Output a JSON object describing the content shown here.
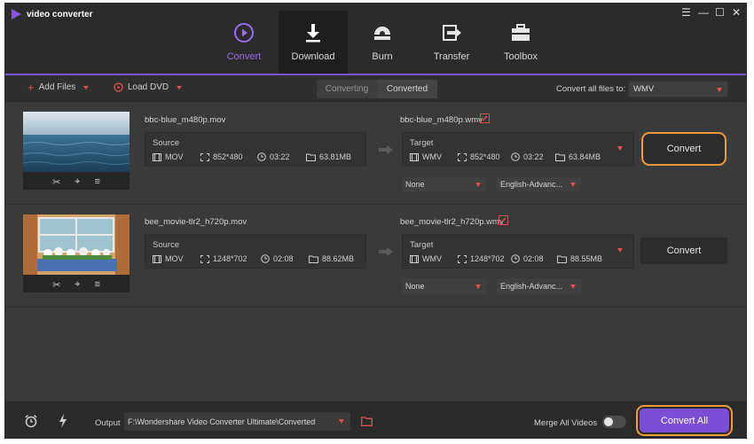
{
  "app": {
    "title": "video converter",
    "window_controls": [
      "menu",
      "minimize",
      "maximize",
      "close"
    ]
  },
  "nav": {
    "items": [
      {
        "label": "Convert",
        "icon": "convert-icon",
        "state": "active"
      },
      {
        "label": "Download",
        "icon": "download-icon",
        "state": "hover"
      },
      {
        "label": "Burn",
        "icon": "burn-icon",
        "state": "normal"
      },
      {
        "label": "Transfer",
        "icon": "transfer-icon",
        "state": "normal"
      },
      {
        "label": "Toolbox",
        "icon": "toolbox-icon",
        "state": "normal"
      }
    ],
    "accent_color": "#9a6cf0"
  },
  "toolbar": {
    "add_files": "Add Files",
    "load_dvd": "Load DVD",
    "tabs": [
      "Converting",
      "Converted"
    ],
    "active_tab": "Converting",
    "convert_all_label": "Convert all files to:",
    "convert_all_format": "WMV"
  },
  "files": [
    {
      "source_name": "bbc-blue_m480p.mov",
      "target_name": "bbc-blue_m480p.wmv",
      "source": {
        "label": "Source",
        "format": "MOV",
        "resolution": "852*480",
        "duration": "03:22",
        "size": "63.81MB"
      },
      "target": {
        "label": "Target",
        "format": "WMV",
        "resolution": "852*480",
        "duration": "03:22",
        "size": "63.84MB"
      },
      "subtitle": "None",
      "audio": "English-Advanc...",
      "convert_label": "Convert",
      "thumbnail": "ocean-scene"
    },
    {
      "source_name": "bee_movie-tlr2_h720p.mov",
      "target_name": "bee_movie-tlr2_h720p.wmv",
      "source": {
        "label": "Source",
        "format": "MOV",
        "resolution": "1248*702",
        "duration": "02:08",
        "size": "88.62MB"
      },
      "target": {
        "label": "Target",
        "format": "WMV",
        "resolution": "1248*702",
        "duration": "02:08",
        "size": "88.55MB"
      },
      "subtitle": "None",
      "audio": "English-Advanc...",
      "convert_label": "Convert",
      "thumbnail": "window-flowerbox-scene"
    }
  ],
  "bottom": {
    "output_label": "Output",
    "output_path": "F:\\Wondershare Video Converter Ultimate\\Converted",
    "merge_label": "Merge All Videos",
    "merge_enabled": false,
    "convert_all_button": "Convert All"
  },
  "colors": {
    "purple": "#7a4fd3",
    "highlight_orange": "#f29a3c",
    "red_accent": "#e04f4f"
  }
}
